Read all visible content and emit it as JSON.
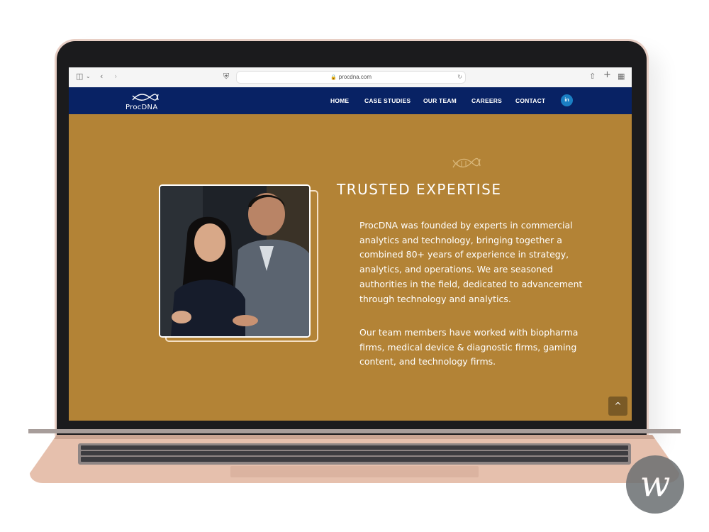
{
  "browser": {
    "url": "procdna.com",
    "icons": {
      "sidebar": "sidebar-icon",
      "back": "back-icon",
      "forward": "forward-icon",
      "shield": "shield-icon",
      "share": "share-icon",
      "new_tab": "plus-icon",
      "tabs": "tabs-grid-icon"
    }
  },
  "nav": {
    "logo_text": "ProcDNA",
    "items": [
      "HOME",
      "CASE STUDIES",
      "OUR TEAM",
      "CAREERS",
      "CONTACT"
    ],
    "linkedin": "in",
    "colors": {
      "background": "#082264",
      "linkedin": "#1a7fc4"
    }
  },
  "hero": {
    "title": "TRUSTED EXPERTISE",
    "paragraph1": "ProcDNA was founded by experts in commercial analytics and technology, bringing together a combined 80+ years of experience in strategy, analytics, and operations. We are seasoned authorities in the field, dedicated to advancement through technology and analytics.",
    "paragraph2": "Our team members have worked with biopharma firms, medical device & diagnostic firms, gaming content, and technology firms.",
    "background": "#b38336",
    "image_alt": "two colleagues in discussion"
  },
  "scroll_top": "^",
  "watermark": "w"
}
